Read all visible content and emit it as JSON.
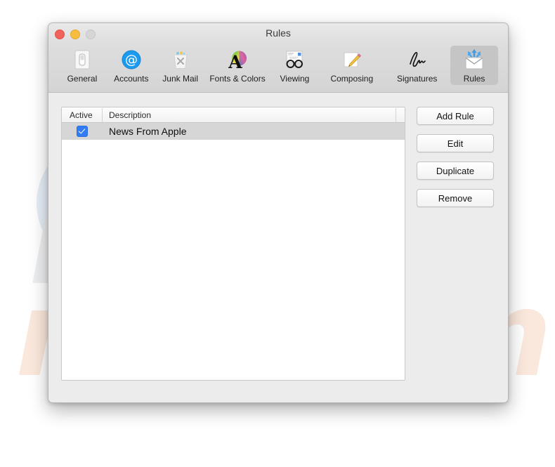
{
  "window": {
    "title": "Rules",
    "traffic_lights": [
      {
        "name": "close",
        "color": "#f1635b"
      },
      {
        "name": "minimize",
        "color": "#f7bd3e"
      },
      {
        "name": "zoom",
        "color": "#d6d6d6"
      }
    ]
  },
  "toolbar": {
    "items": [
      {
        "label": "General",
        "icon": "light-switch-icon",
        "selected": false
      },
      {
        "label": "Accounts",
        "icon": "at-sign-icon",
        "selected": false
      },
      {
        "label": "Junk Mail",
        "icon": "trash-bin-icon",
        "selected": false
      },
      {
        "label": "Fonts & Colors",
        "icon": "font-color-wheel-icon",
        "selected": false
      },
      {
        "label": "Viewing",
        "icon": "eyeglasses-document-icon",
        "selected": false
      },
      {
        "label": "Composing",
        "icon": "pencil-note-icon",
        "selected": false
      },
      {
        "label": "Signatures",
        "icon": "signature-icon",
        "selected": false
      },
      {
        "label": "Rules",
        "icon": "envelope-arrows-icon",
        "selected": true
      }
    ]
  },
  "table": {
    "columns": [
      "Active",
      "Description"
    ],
    "rows": [
      {
        "active": true,
        "description": "News From Apple",
        "selected": true
      }
    ]
  },
  "buttons": [
    {
      "label": "Add Rule",
      "name": "add-rule-button"
    },
    {
      "label": "Edit",
      "name": "edit-button"
    },
    {
      "label": "Duplicate",
      "name": "duplicate-button"
    },
    {
      "label": "Remove",
      "name": "remove-button"
    }
  ],
  "help": {
    "glyph": "?"
  },
  "watermark": {
    "primary": "PC",
    "secondary": "risk.com",
    "primary_color": "#eceef0",
    "secondary_color": "#fbe8dc"
  },
  "colors": {
    "accent": "#2f7cf6",
    "window_bg": "#ececec",
    "toolbar_bg": "#d9d9da",
    "selection": "#d6d6d6"
  }
}
